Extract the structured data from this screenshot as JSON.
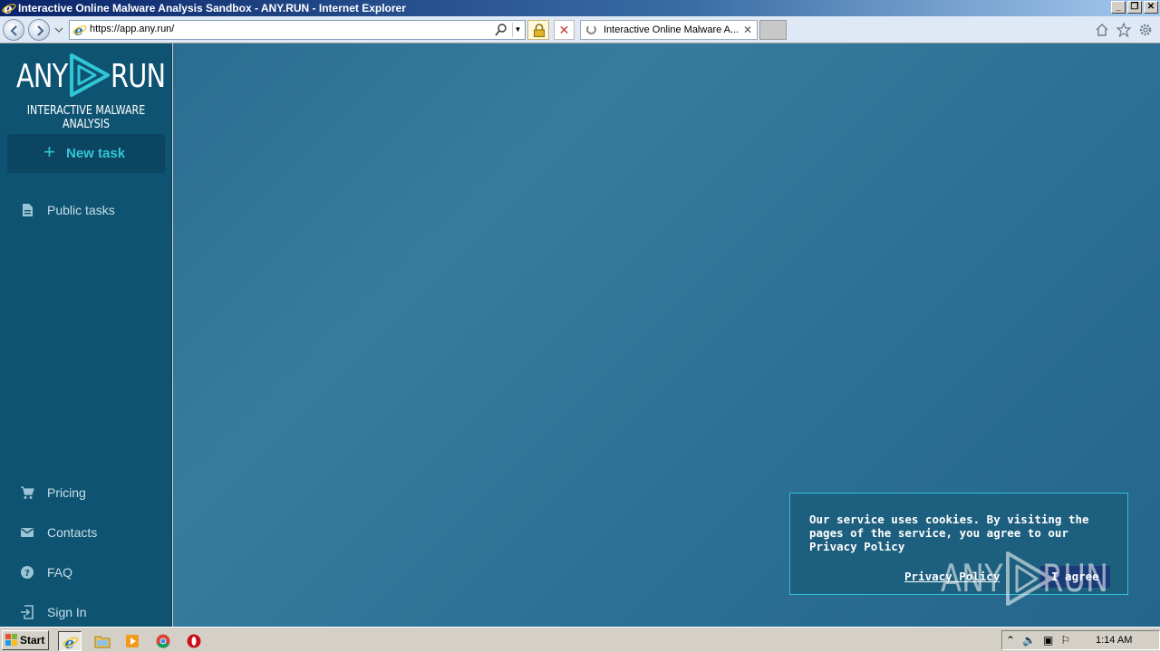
{
  "browser": {
    "window_title": "Interactive Online Malware Analysis Sandbox - ANY.RUN - Internet Explorer",
    "url": "https://app.any.run/",
    "tab_title": "Interactive Online Malware A...",
    "controls": {
      "minimize": "_",
      "restore": "❐",
      "close": "✕"
    }
  },
  "app": {
    "logo": {
      "left": "ANY",
      "right": "RUN",
      "subtitle": "INTERACTIVE MALWARE ANALYSIS"
    },
    "new_task_label": "New task",
    "nav_top": [
      {
        "label": "Public tasks",
        "icon": "document-icon"
      }
    ],
    "nav_bottom": [
      {
        "label": "Pricing",
        "icon": "cart-icon"
      },
      {
        "label": "Contacts",
        "icon": "mail-icon"
      },
      {
        "label": "FAQ",
        "icon": "help-icon"
      },
      {
        "label": "Sign In",
        "icon": "signin-icon"
      }
    ],
    "cookie": {
      "text": "Our service uses cookies. By visiting the pages of the service, you agree to our Privacy Policy",
      "privacy_link": "Privacy Policy",
      "agree_button": "I agree"
    },
    "watermark": {
      "left": "ANY",
      "right": "RUN"
    },
    "colors": {
      "sidebar": "#0e5472",
      "accent": "#31c6d6",
      "main": "#2d7196"
    }
  },
  "taskbar": {
    "start_label": "Start",
    "clock": "1:14 AM",
    "apps": [
      "internet-explorer-icon",
      "explorer-folder-icon",
      "media-player-icon",
      "chrome-icon",
      "opera-icon"
    ]
  }
}
